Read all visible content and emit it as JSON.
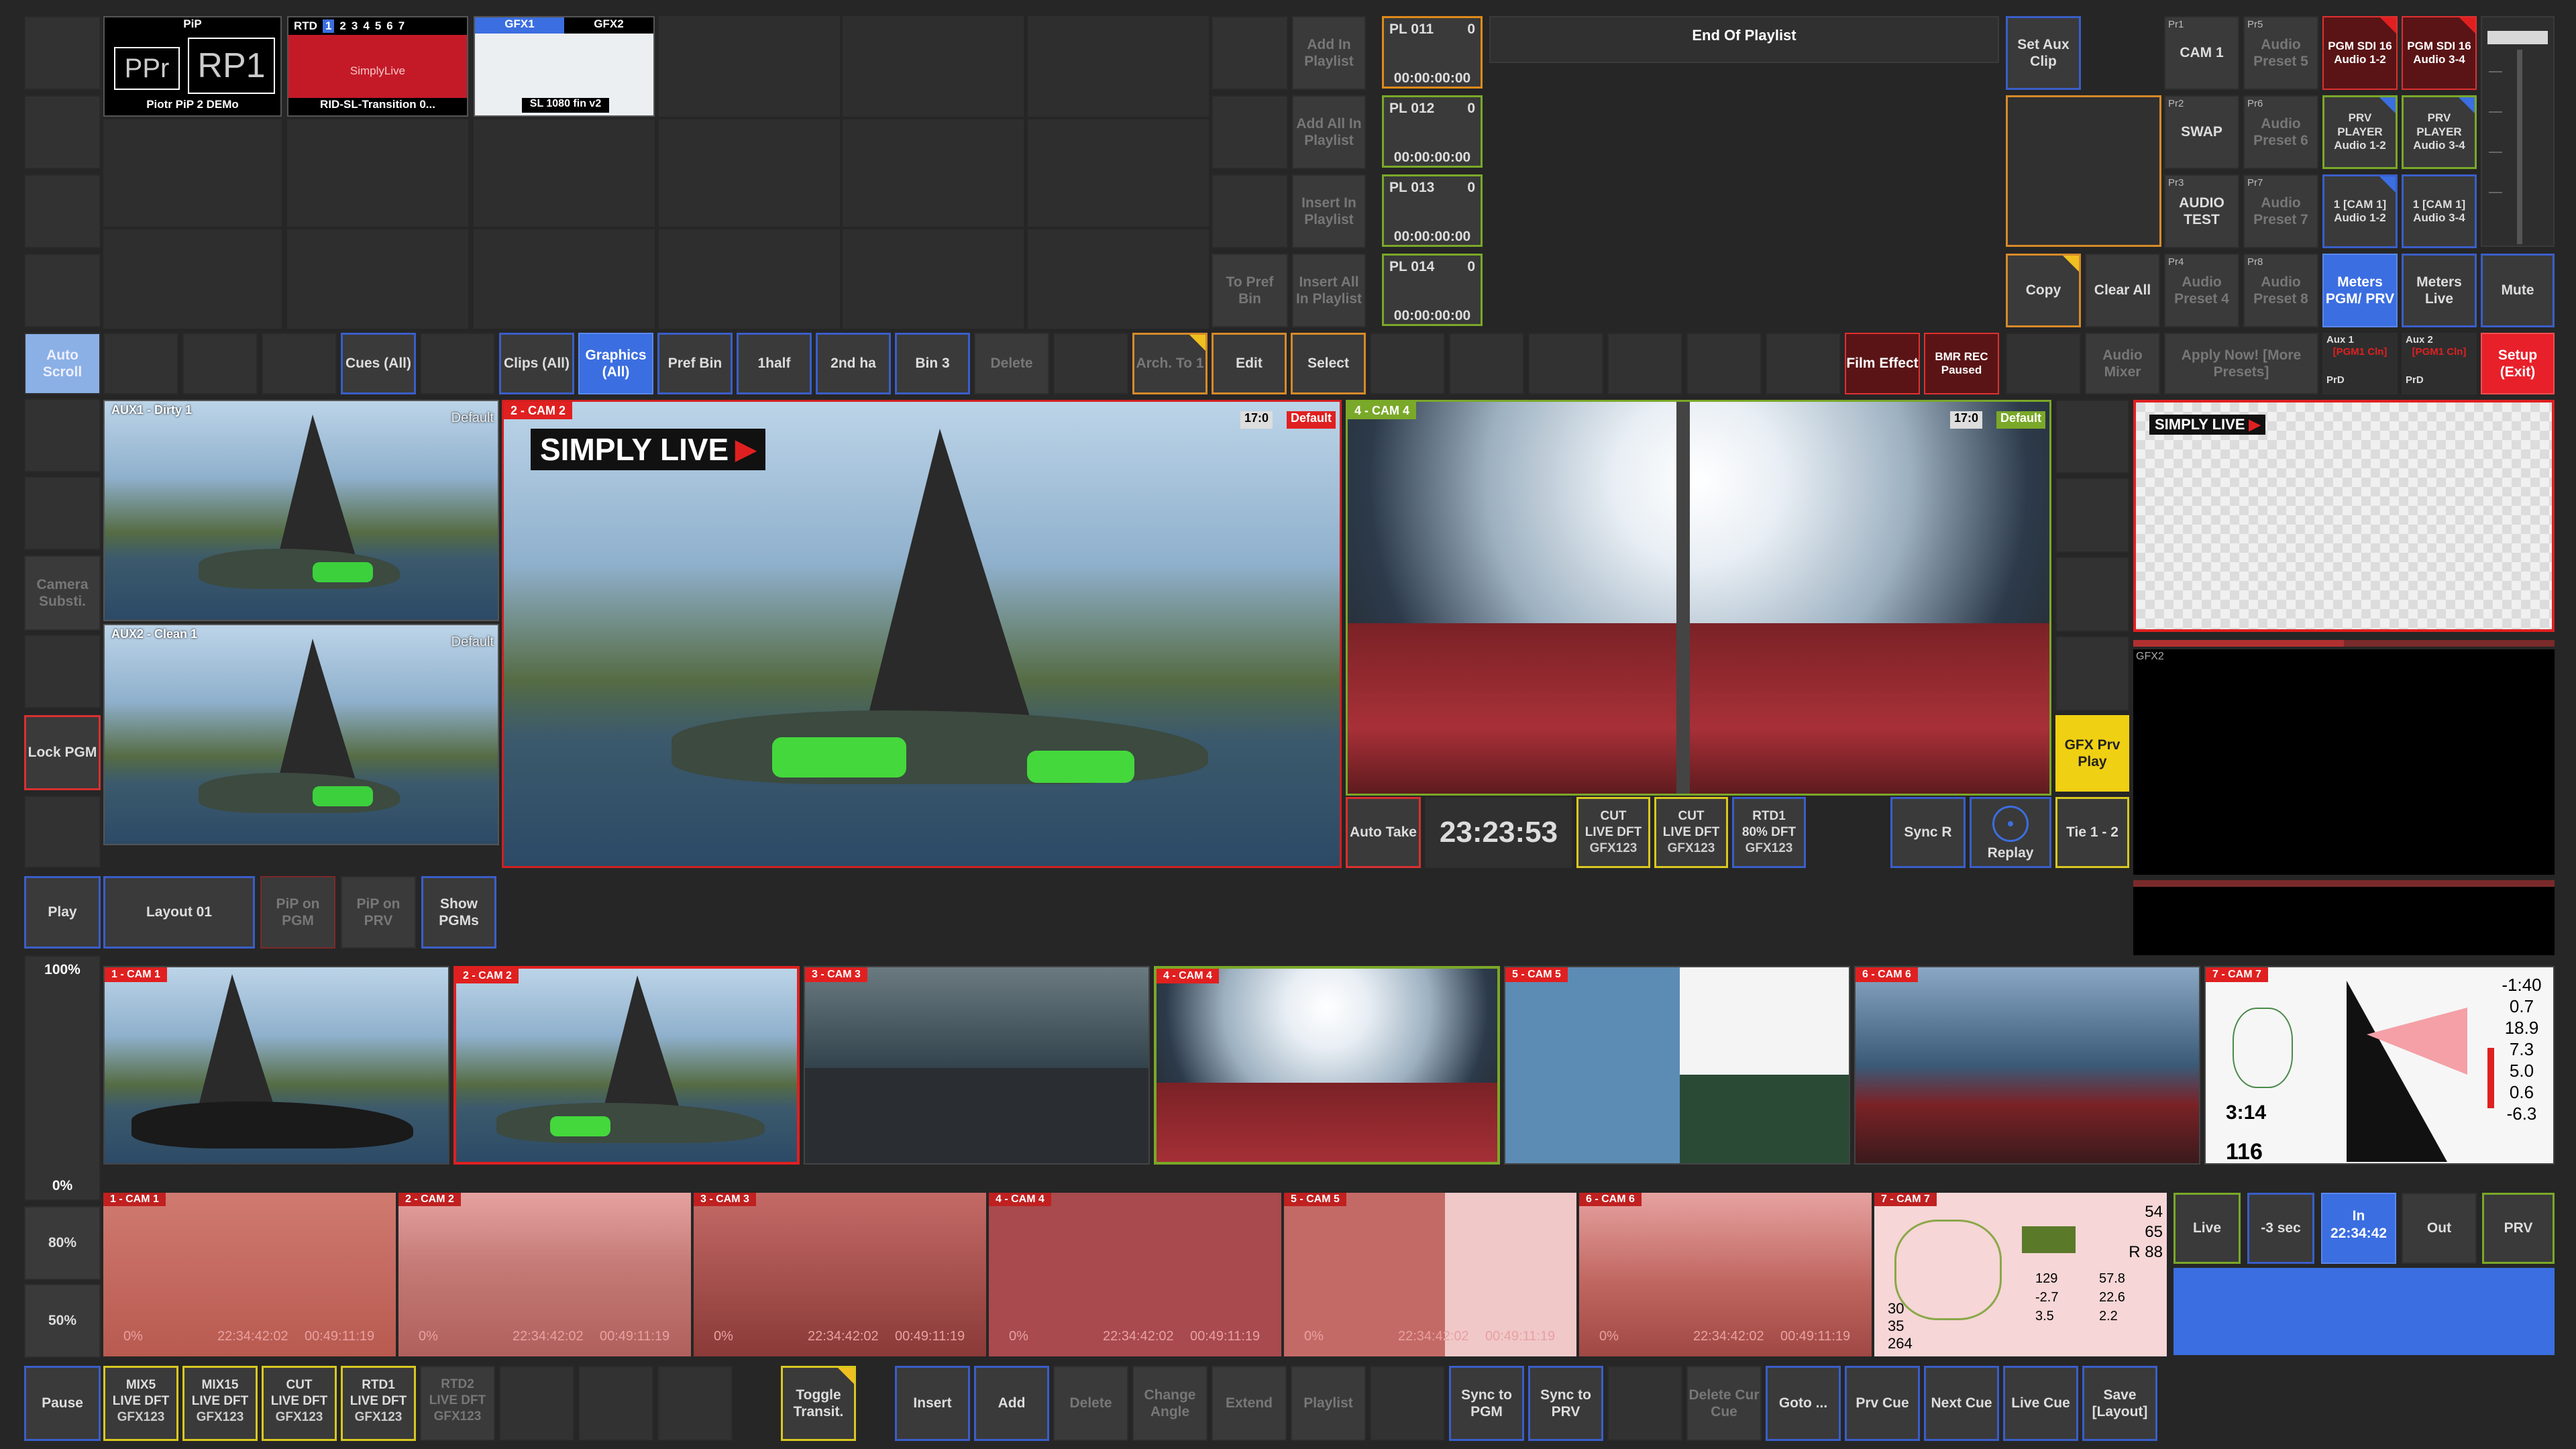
{
  "top_thumbs": {
    "pip": {
      "header": "PiP",
      "left": "PPr",
      "right": "RP1",
      "caption": "Piotr PiP 2 DEMo"
    },
    "rtd": {
      "header": "RTD",
      "nums": [
        "1",
        "2",
        "3",
        "4",
        "5",
        "6",
        "7"
      ],
      "logo": "SimplyLive",
      "caption": "RID-SL-Transition 0..."
    },
    "gfx": {
      "tabs": [
        "GFX1",
        "GFX2"
      ],
      "caption": "SL 1080 fin v2"
    }
  },
  "playlist_cmds": [
    "Add In Playlist",
    "Add All In Playlist",
    "Insert In Playlist",
    "Insert All In Playlist"
  ],
  "to_pref_bin": "To Pref Bin",
  "playlist_items": [
    {
      "name": "PL 011",
      "count": "0",
      "time": "00:00:00:00"
    },
    {
      "name": "PL 012",
      "count": "0",
      "time": "00:00:00:00"
    },
    {
      "name": "PL 013",
      "count": "0",
      "time": "00:00:00:00"
    },
    {
      "name": "PL 014",
      "count": "0",
      "time": "00:00:00:00"
    }
  ],
  "end_of_playlist": "End Of Playlist",
  "right_top": {
    "set_aux_clip": "Set Aux Clip",
    "copy": "Copy",
    "clear_all": "Clear All",
    "presets": [
      {
        "tag": "Pr1",
        "label": "CAM 1"
      },
      {
        "tag": "Pr2",
        "label": "SWAP"
      },
      {
        "tag": "Pr3",
        "label": "AUDIO TEST"
      },
      {
        "tag": "Pr4",
        "label": "Audio Preset 4"
      }
    ],
    "audio_presets": [
      {
        "tag": "Pr5",
        "label": "Audio Preset 5"
      },
      {
        "tag": "Pr6",
        "label": "Audio Preset 6"
      },
      {
        "tag": "Pr7",
        "label": "Audio Preset 7"
      },
      {
        "tag": "Pr8",
        "label": "Audio Preset 8"
      }
    ],
    "audio_routes": [
      "PGM SDI 16 Audio 1-2",
      "PGM SDI 16 Audio 3-4",
      "PRV PLAYER Audio 1-2",
      "PRV PLAYER Audio 3-4",
      "1 [CAM 1] Audio 1-2",
      "1 [CAM 1] Audio 3-4"
    ],
    "meters_pgm": "Meters PGM/ PRV",
    "meters_live": "Meters Live",
    "mute": "Mute"
  },
  "toolbar": {
    "auto_scroll": "Auto Scroll",
    "cues": "Cues (All)",
    "clips": "Clips (All)",
    "graphics": "Graphics (All)",
    "pref_bin": "Pref Bin",
    "half1": "1half",
    "half2": "2nd ha",
    "bin3": "Bin 3",
    "delete": "Delete",
    "arch_to": "Arch. To 1",
    "edit": "Edit",
    "select": "Select",
    "film_effect": "Film Effect",
    "bmr_rec": "BMR REC Paused",
    "audio_mixer": "Audio Mixer",
    "apply_now": "Apply Now! [More Presets]",
    "aux1": "Aux 1",
    "aux1_sub": "[PGM1 Cln]",
    "aux2": "Aux 2",
    "aux2_sub": "[PGM1 Cln]",
    "prd": "PrD",
    "setup": "Setup (Exit)"
  },
  "left_col": {
    "camera_subst": "Camera Substi.",
    "lock_pgm": "Lock PGM",
    "play": "Play",
    "pct100": "100%",
    "pct0": "0%",
    "pct80": "80%",
    "pct50": "50%",
    "pause": "Pause"
  },
  "monitors": {
    "aux1": {
      "label": "AUX1 - Dirty 1",
      "badge": "Default"
    },
    "aux2": {
      "label": "AUX2 - Clean 1",
      "badge": "Default"
    },
    "pgm": {
      "label": "2 - CAM 2",
      "badge": "Default",
      "ratio": "17:0",
      "logo": "SIMPLY LIVE"
    },
    "prv": {
      "label": "4 - CAM 4",
      "badge": "Default",
      "ratio": "17:0"
    },
    "gfx_prv_logo": "SIMPLY LIVE",
    "gfx2": "GFX2"
  },
  "mid_controls": {
    "layout": "Layout 01",
    "pip_on_pgm": "PiP on PGM",
    "pip_on_prv": "PiP on PRV",
    "show_pgms": "Show PGMs",
    "auto_take": "Auto Take",
    "clock": "23:23:53",
    "cut1": {
      "t": "CUT",
      "s": "LIVE DFT",
      "g": "GFX123"
    },
    "cut2": {
      "t": "CUT",
      "s": "LIVE DFT",
      "g": "GFX123"
    },
    "rtd1": {
      "t": "RTD1",
      "s": "80% DFT",
      "g": "GFX123"
    },
    "sync_r": "Sync R",
    "replay": "Replay",
    "tie": "Tie 1 - 2",
    "gfx_prv_play": "GFX Prv Play"
  },
  "cam_strip": [
    "1 - CAM 1",
    "2 - CAM 2",
    "3 - CAM 3",
    "4 - CAM 4",
    "5 - CAM 5",
    "6 - CAM 6",
    "7 - CAM 7"
  ],
  "cam7_values": [
    "-1:40",
    "0.7",
    "18.9",
    "7.3",
    "5.0",
    "0.6",
    "-6.3",
    "3:14",
    "116"
  ],
  "replay_strip": {
    "cams": [
      "1 - CAM 1",
      "2 - CAM 2",
      "3 - CAM 3",
      "4 - CAM 4",
      "5 - CAM 5",
      "6 - CAM 6",
      "7 - CAM 7"
    ],
    "pct": "0%",
    "tc1": "22:34:42:02",
    "tc2": "00:49:11:19",
    "cam7_values": [
      "54",
      "65",
      "R 88",
      "129",
      "57.8",
      "-2.7",
      "22.6",
      "3.5",
      "2.2",
      "30",
      "35",
      "264"
    ]
  },
  "right_controls": {
    "live": "Live",
    "minus3": "-3 sec",
    "in_label": "In",
    "in_time": "22:34:42",
    "out": "Out",
    "prv": "PRV"
  },
  "bottom": {
    "mix5": {
      "t": "MIX5",
      "s": "LIVE DFT",
      "g": "GFX123"
    },
    "mix15": {
      "t": "MIX15",
      "s": "LIVE DFT",
      "g": "GFX123"
    },
    "cut": {
      "t": "CUT",
      "s": "LIVE DFT",
      "g": "GFX123"
    },
    "rtd1": {
      "t": "RTD1",
      "s": "LIVE DFT",
      "g": "GFX123"
    },
    "rtd2": {
      "t": "RTD2",
      "s": "LIVE DFT",
      "g": "GFX123"
    },
    "toggle": "Toggle Transit.",
    "insert": "Insert",
    "add": "Add",
    "delete": "Delete",
    "change_angle": "Change Angle",
    "extend": "Extend",
    "playlist": "Playlist",
    "sync_pgm": "Sync to PGM",
    "sync_prv": "Sync to PRV",
    "delete_cur": "Delete Cur Cue",
    "goto": "Goto ...",
    "prv_cue": "Prv Cue",
    "next_cue": "Next Cue",
    "live_cue": "Live Cue",
    "save_layout": "Save [Layout]"
  }
}
